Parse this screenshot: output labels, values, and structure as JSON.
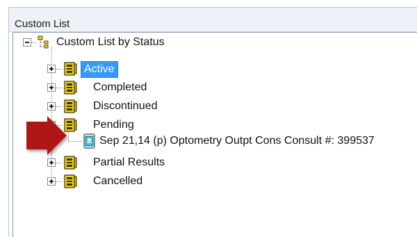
{
  "panel": {
    "title": "Custom List"
  },
  "tree": {
    "root": {
      "label": "Custom List by Status",
      "icon": "tree-structure-icon"
    },
    "nodes": [
      {
        "label": "Active",
        "icon": "folder-stack-icon",
        "selected": true
      },
      {
        "label": "Completed",
        "icon": "folder-stack-icon"
      },
      {
        "label": "Discontinued",
        "icon": "folder-stack-icon"
      },
      {
        "label": "Pending",
        "icon": "folder-stack-icon",
        "expanded": true
      },
      {
        "label": "Partial Results",
        "icon": "folder-stack-icon"
      },
      {
        "label": "Cancelled",
        "icon": "folder-stack-icon"
      }
    ],
    "child": {
      "label": "Sep 21,14  (p)  Optometry Outpt Cons Consult #: 399537",
      "icon": "consult-document-icon"
    }
  },
  "colors": {
    "selection": "#3399ff",
    "arrow": "#b01416",
    "folder": "#e8d21a"
  }
}
